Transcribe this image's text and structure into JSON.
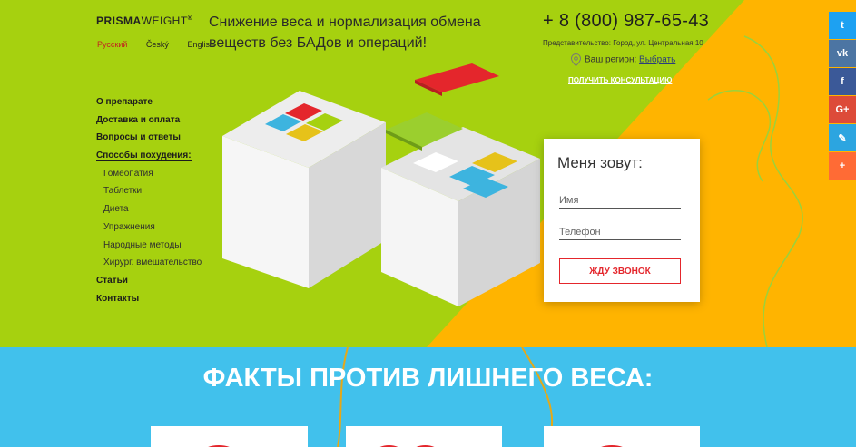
{
  "header": {
    "logo_bold": "PRISMA",
    "logo_light": "WEIGHT",
    "logo_mark": "®",
    "languages": [
      "Русский",
      "Český",
      "English"
    ],
    "tagline": "Снижение веса и нормализация обмена веществ без БАДов и операций!",
    "phone": "+ 8 (800) 987-65-43",
    "office": "Представительство: Город, ул. Центральная 10",
    "region_label": "Ваш регион:",
    "region_link": "Выбрать",
    "consult_link": "ПОЛУЧИТЬ КОНСУЛЬТАЦИЮ"
  },
  "nav": {
    "items": [
      "О препарате",
      "Доставка и оплата",
      "Вопросы и ответы",
      "Способы похудения:"
    ],
    "subitems": [
      "Гомеопатия",
      "Таблетки",
      "Диета",
      "Упражнения",
      "Народные методы",
      "Хирург. вмешательство"
    ],
    "tail": [
      "Статьи",
      "Контакты"
    ]
  },
  "form": {
    "title": "Меня зовут:",
    "name_placeholder": "Имя",
    "phone_placeholder": "Телефон",
    "button": "ЖДУ ЗВОНОК"
  },
  "social": {
    "icons": [
      "twitter-icon",
      "vk-icon",
      "facebook-icon",
      "google-plus-icon",
      "clip-icon",
      "plus-icon"
    ],
    "glyphs": [
      "t",
      "vk",
      "f",
      "G+",
      "✎",
      "+"
    ],
    "colors": [
      "#1da1f2",
      "#4c75a3",
      "#3b5998",
      "#dd4b39",
      "#2ca5e0",
      "#ff6b35"
    ]
  },
  "facts": {
    "title": "ФАКТЫ ПРОТИВ ЛИШНЕГО ВЕСА:"
  },
  "colors": {
    "hero_green": "#a6d10f",
    "hero_orange": "#ffb400",
    "facts_blue": "#41c1ec",
    "accent_red": "#e4262c"
  }
}
